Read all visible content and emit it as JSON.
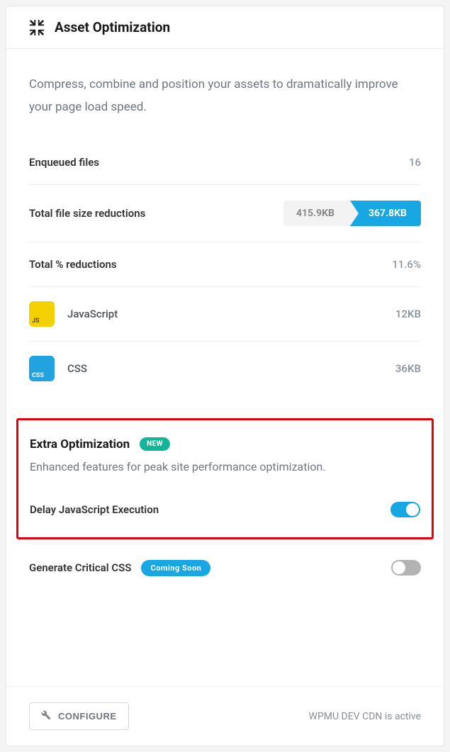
{
  "header": {
    "title": "Asset Optimization"
  },
  "description": "Compress, combine and position your assets to dramatically improve your page load speed.",
  "stats": {
    "enqueued": {
      "label": "Enqueued files",
      "value": "16"
    },
    "size_reductions": {
      "label": "Total file size reductions",
      "before": "415.9KB",
      "after": "367.8KB"
    },
    "percent_reductions": {
      "label": "Total % reductions",
      "value": "11.6%"
    }
  },
  "assets": {
    "js": {
      "badge": "JS",
      "name": "JavaScript",
      "size": "12KB"
    },
    "css": {
      "badge": "CSS",
      "name": "CSS",
      "size": "36KB"
    }
  },
  "extra": {
    "title": "Extra Optimization",
    "badge": "NEW",
    "desc": "Enhanced features for peak site performance optimization.",
    "delay_js": {
      "label": "Delay JavaScript Execution"
    }
  },
  "critical_css": {
    "label": "Generate Critical CSS",
    "badge": "Coming Soon"
  },
  "footer": {
    "configure": "CONFIGURE",
    "note": "WPMU DEV CDN is active"
  }
}
